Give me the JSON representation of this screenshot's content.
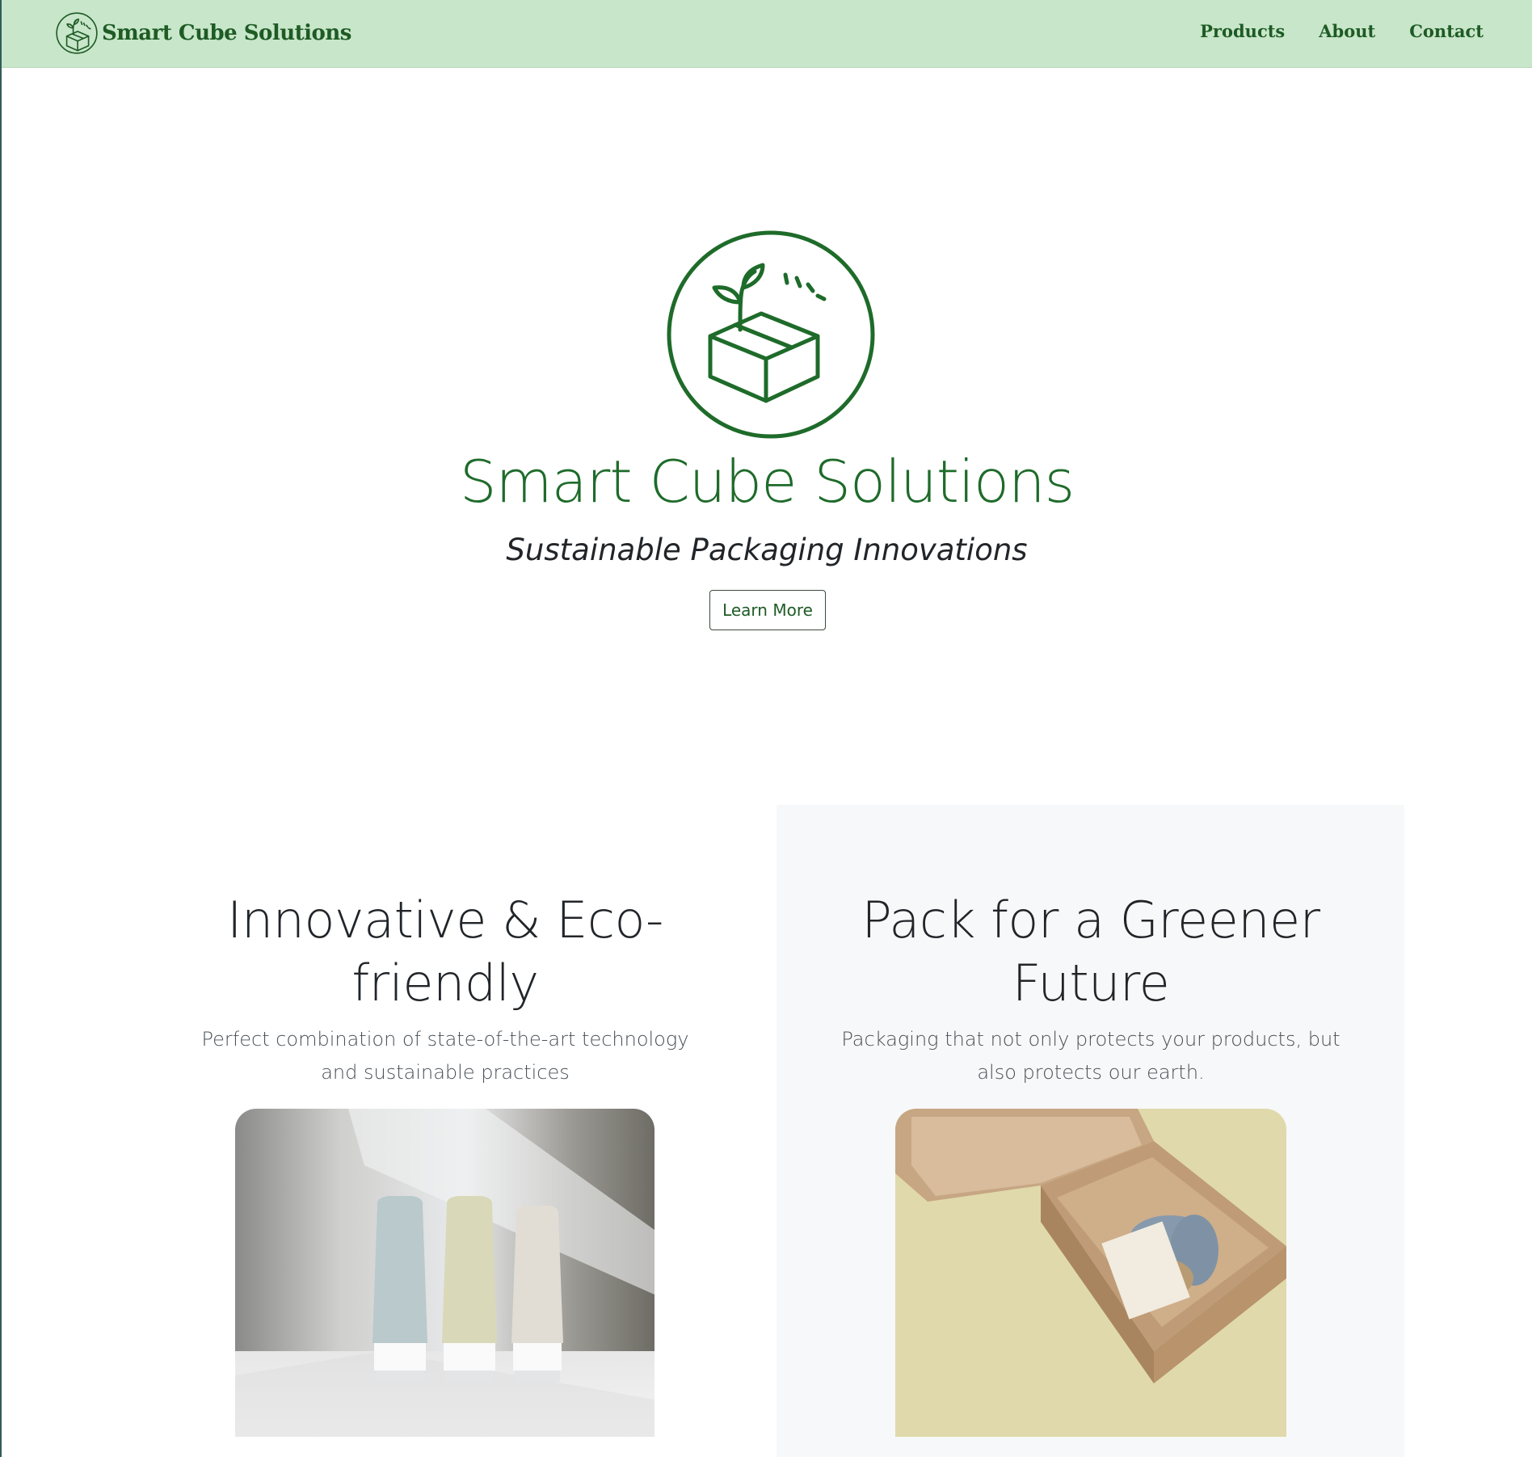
{
  "navbar": {
    "brand_text": "Smart Cube Solutions",
    "links": [
      {
        "label": "Products"
      },
      {
        "label": "About"
      },
      {
        "label": "Contact"
      }
    ]
  },
  "hero": {
    "title": "Smart Cube Solutions",
    "subtitle": "Sustainable Packaging Innovations",
    "button_label": "Learn More"
  },
  "features": [
    {
      "title": "Innovative & Eco-friendly",
      "text": "Perfect combination of state-of-the-art technology and sustainable practices"
    },
    {
      "title": "Pack for a Greener Future",
      "text": "Packaging that not only protects your products, but also protects our earth."
    }
  ],
  "colors": {
    "navbar_bg": "#c8e6c9",
    "brand_green": "#1e5b25",
    "hero_green": "#1e6b2a",
    "feature_panel_bg": "#f7f8f9"
  },
  "icons": {
    "brand_logo": "sprout-box-icon",
    "hero_logo": "sprout-box-icon"
  }
}
